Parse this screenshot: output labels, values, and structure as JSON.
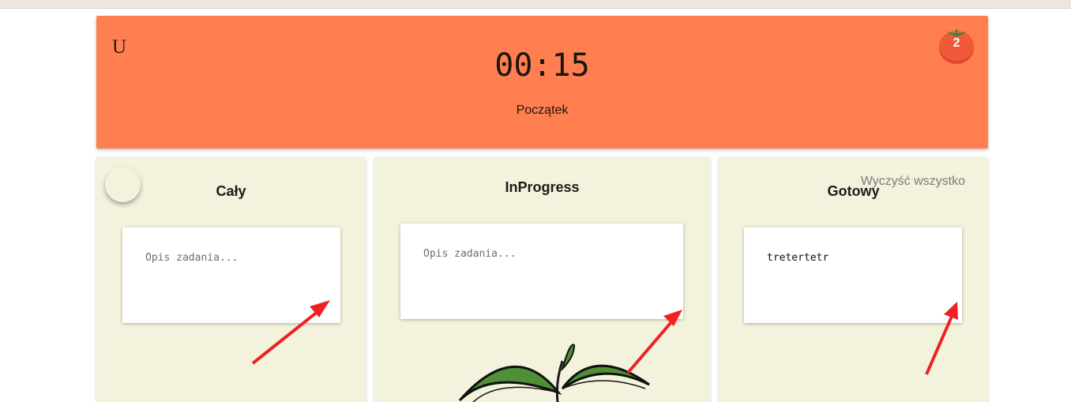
{
  "header": {
    "letter": "U",
    "timer": "00:15",
    "start_label": "Początek",
    "tomato_count": "2",
    "accent_color": "#ff7f50"
  },
  "columns": {
    "all": {
      "title": "Cały",
      "task_placeholder": "Opis zadania..."
    },
    "inprogress": {
      "title": "InProgress",
      "task_placeholder": "Opis zadania..."
    },
    "done": {
      "title": "Gotowy",
      "clear_label": "Wyczyść wszystko",
      "task_text": "tretertetr"
    }
  },
  "icons": [
    "tomato-icon",
    "plant-illustration",
    "red-arrow-icon"
  ]
}
